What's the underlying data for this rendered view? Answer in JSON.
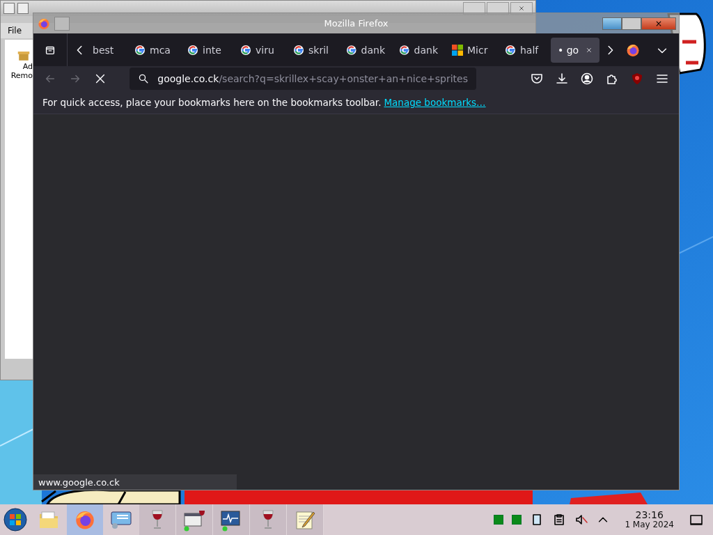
{
  "background_window": {
    "menu": [
      {
        "label": "File"
      }
    ],
    "tool_label_lines": [
      "Ad",
      "Remo"
    ]
  },
  "browser": {
    "title": "Mozilla Firefox",
    "tabs": [
      {
        "label": "best",
        "kind": "plain",
        "selected": false
      },
      {
        "label": "mca",
        "kind": "google",
        "selected": false
      },
      {
        "label": "inte",
        "kind": "google",
        "selected": false
      },
      {
        "label": "viru",
        "kind": "google",
        "selected": false
      },
      {
        "label": "skril",
        "kind": "google",
        "selected": false
      },
      {
        "label": "dank",
        "kind": "google",
        "selected": false
      },
      {
        "label": "dank",
        "kind": "google",
        "selected": false
      },
      {
        "label": "Micr",
        "kind": "microsoft",
        "selected": false
      },
      {
        "label": "half",
        "kind": "google",
        "selected": false
      },
      {
        "label": "• go",
        "kind": "plain",
        "selected": true
      }
    ],
    "nav_buttons": [
      {
        "kind": "back",
        "disabled": true
      },
      {
        "kind": "forward",
        "disabled": true
      },
      {
        "kind": "stop",
        "disabled": false
      }
    ],
    "url": {
      "host": "google.co.ck",
      "path": "/search?q=skrillex+scay+onster+an+nice+sprites"
    },
    "bookmarks_bar": {
      "message": "For quick access, place your bookmarks here on the bookmarks toolbar.",
      "link": "Manage bookmarks…"
    },
    "status": "www.google.co.ck"
  },
  "taskbar": {
    "items": [
      {
        "kind": "folder",
        "selected": false
      },
      {
        "kind": "firefox",
        "selected": true
      },
      {
        "kind": "control-panel",
        "selected": false
      },
      {
        "kind": "wine",
        "selected": false
      },
      {
        "kind": "wine-app",
        "selected": false
      },
      {
        "kind": "monitor",
        "selected": false
      },
      {
        "kind": "wine",
        "selected": false
      },
      {
        "kind": "notepad",
        "selected": false
      }
    ],
    "clock": {
      "time": "23:16",
      "date": "1 May 2024"
    }
  }
}
